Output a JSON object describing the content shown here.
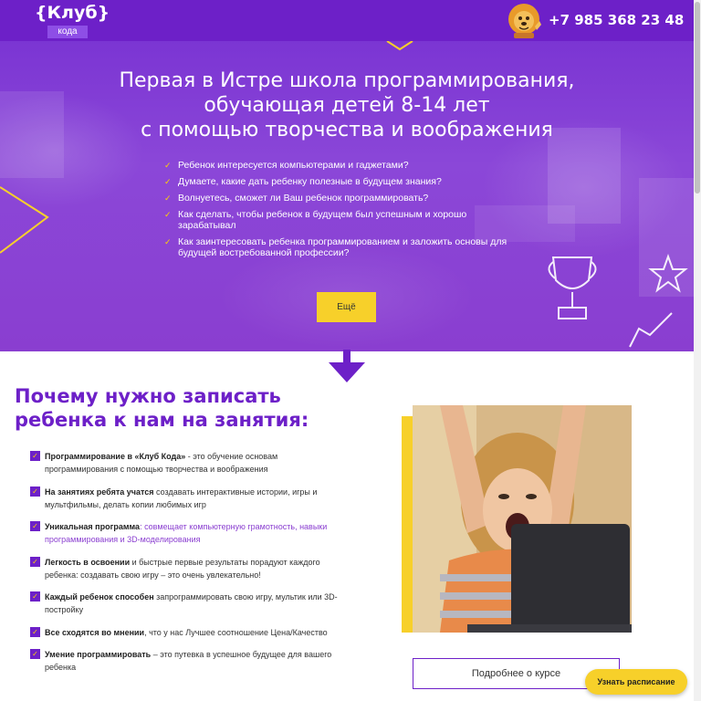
{
  "header": {
    "logo_main": "{Клуб}",
    "logo_sub": "кода",
    "phone": "+7 985 368 23 48"
  },
  "hero": {
    "title_lines": [
      "Первая в Истре школа программирования,",
      "обучающая детей 8-14 лет",
      "с помощью творчества и воображения"
    ],
    "list": [
      "Ребенок интересуется компьютерами и гаджетами?",
      "Думаете, какие дать ребенку полезные в будущем знания?",
      "Волнуетесь, сможет ли Ваш ребенок программировать?",
      "Как сделать, чтобы ребенок в будущем был успешным и хорошо зарабатывал",
      "Как заинтересовать ребенка программированием и заложить основы для будущей востребованной профессии?"
    ],
    "more_button": "Ещё"
  },
  "why": {
    "title": "Почему нужно записать ребенка к нам на занятия:",
    "items": [
      {
        "bold": "Программирование в «Клуб Кода»",
        "text": " - это обучение основам программирования с помощью творчества и воображения"
      },
      {
        "bold": "На занятиях ребята учатся",
        "text": " создавать интерактивные истории, игры и мультфильмы, делать копии любимых игр"
      },
      {
        "bold": "Уникальная программа",
        "text": ": совмещает компьютерную грамотность, навыки программирования и 3D-моделирования"
      },
      {
        "bold": "Легкость в освоении",
        "text": " и быстрые первые результаты порадуют каждого ребенка: создавать свою игру – это очень увлекательно!"
      },
      {
        "bold": "Каждый ребенок способен",
        "text": " запрограммировать свою игру, мультик или 3D-постройку"
      },
      {
        "bold": "Все сходятся во мнении",
        "text": ", что у нас Лучшее соотношение Цена/Качество"
      },
      {
        "bold": "Умение программировать",
        "text": " – это путевка в успешное будущее для вашего ребенка"
      }
    ]
  },
  "buttons": {
    "course": "Подробнее о курсе",
    "schedule": "Узнать расписание"
  },
  "colors": {
    "brand_purple": "#6d20c8",
    "accent_yellow": "#f7d02a"
  }
}
